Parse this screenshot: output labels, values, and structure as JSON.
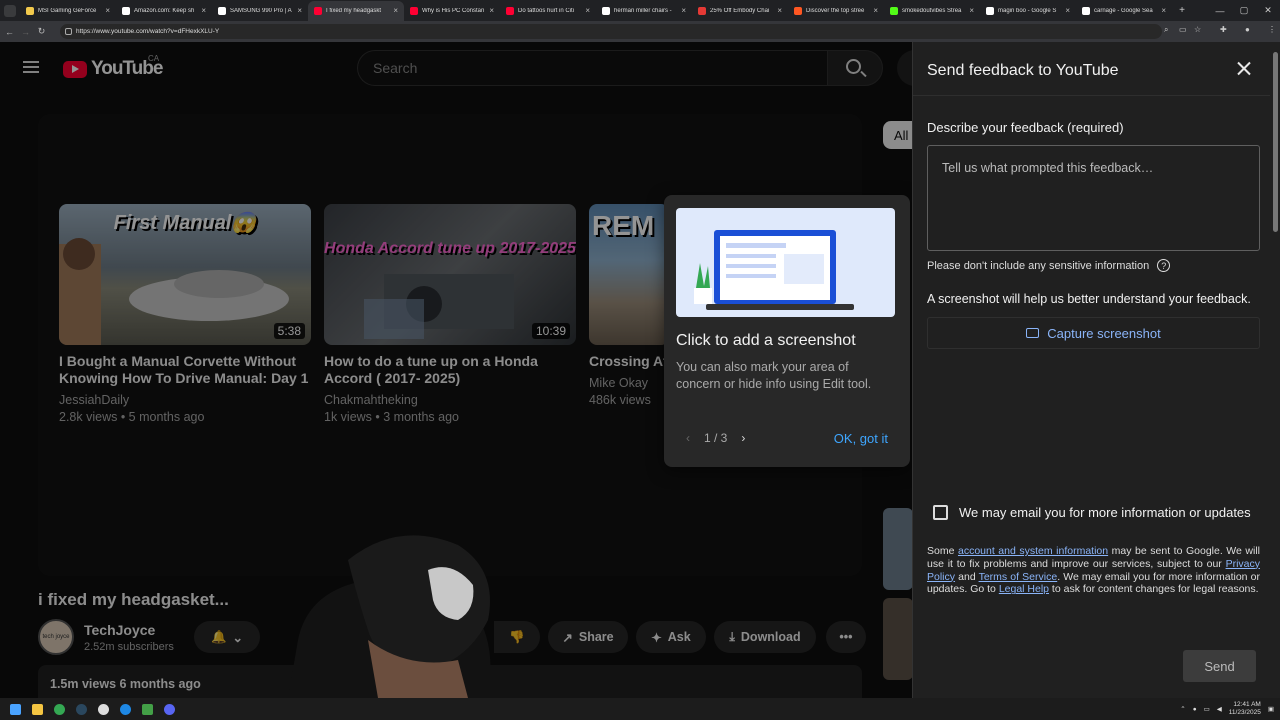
{
  "browser": {
    "tabs": [
      {
        "title": "MSI Gaming GeForce",
        "color": "#f2c94c"
      },
      {
        "title": "Amazon.com: Keep sh",
        "color": "#ffffff"
      },
      {
        "title": "SAMSUNG 990 Pro | A",
        "color": "#ffffff"
      },
      {
        "title": "I fixed my headgaskt",
        "color": "#ff0033"
      },
      {
        "title": "Why is His PC Constan",
        "color": "#ff0033"
      },
      {
        "title": "Do tattoos hurt in Citi",
        "color": "#ff0033"
      },
      {
        "title": "herman miller chairs -",
        "color": "#ffffff"
      },
      {
        "title": "25% Off Embody Chai",
        "color": "#e53935"
      },
      {
        "title": "Discover the top stree",
        "color": "#ff5722"
      },
      {
        "title": "smokedoutvibes Strea",
        "color": "#53fc18"
      },
      {
        "title": "magin boo - Google S",
        "color": "#ffffff"
      },
      {
        "title": "carnage - Google Sea",
        "color": "#ffffff"
      }
    ],
    "new_tab": "+",
    "url": "https://www.youtube.com/watch?v=dFHexkXLU-Y"
  },
  "youtube": {
    "logo_text": "YouTube",
    "country": "CA",
    "search_placeholder": "Search",
    "chip_all": "All",
    "cards": [
      {
        "title": "I Bought a Manual Corvette Without Knowing How To Drive Manual: Day 1",
        "channel": "JessiahDaily",
        "meta": "2.8k views • 5 months ago",
        "duration": "5:38",
        "overlay": "First Manual😱",
        "thumb_color": "#8a9aa8"
      },
      {
        "title": "How to do a tune up on a Honda Accord ( 2017- 2025)",
        "channel": "Chakmahtheking",
        "meta": "1k views • 3 months ago",
        "duration": "10:39",
        "overlay": "Honda Accord tune up 2017-2025",
        "thumb_color": "#4a4f55"
      },
      {
        "title": "Crossing At Mine Route",
        "channel": "Mike Okay",
        "meta": "486k views",
        "duration": "",
        "overlay": "REM",
        "thumb_color": "#6a8fb0"
      }
    ],
    "video_title": "i fixed my headgasket...",
    "channel_name": "TechJoyce",
    "avatar_text": "tech joyce",
    "subscribers": "2.52m subscribers",
    "actions": {
      "share": "Share",
      "ask": "Ask",
      "download": "Download"
    },
    "description_meta": "1.5m views  6 months ago"
  },
  "tooltip": {
    "heading": "Click to add a screenshot",
    "body": "You can also mark your area of concern or hide info using Edit tool.",
    "pager": "1 / 3",
    "ok": "OK, got it"
  },
  "feedback": {
    "title": "Send feedback to YouTube",
    "describe_label": "Describe your feedback (required)",
    "placeholder": "Tell us what prompted this feedback…",
    "warning": "Please don't include any sensitive information",
    "screenshot_prompt": "A screenshot will help us better understand your feedback.",
    "capture_button": "Capture screenshot",
    "email_checkbox": "We may email you for more information or updates",
    "legal": {
      "p1": "Some ",
      "link1": "account and system information",
      "p2": " may be sent to Google. We will use it to fix problems and improve our services, subject to our ",
      "link2": "Privacy Policy",
      "p3": " and ",
      "link3": "Terms of Service",
      "p4": ". We may email you for more information or updates. Go to ",
      "link4": "Legal Help",
      "p5": " to ask for content changes for legal reasons."
    },
    "send": "Send"
  },
  "taskbar": {
    "time": "12:41 AM",
    "date": "11/23/2025"
  }
}
